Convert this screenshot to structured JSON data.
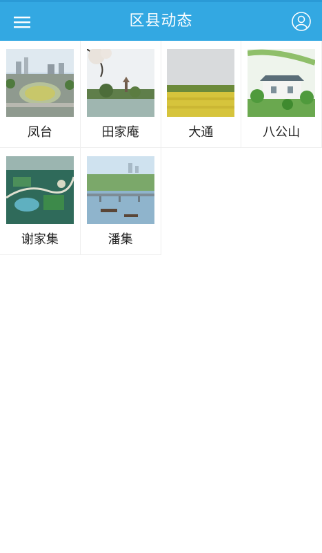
{
  "header": {
    "title": "区县动态",
    "menu_icon": "menu-icon",
    "user_icon": "user-icon"
  },
  "colors": {
    "header_bg": "#33a8e2",
    "header_text": "#ffffff"
  },
  "tiles": [
    {
      "label": "凤台",
      "image": "fengtai-roundabout-photo"
    },
    {
      "label": "田家庵",
      "image": "tianjiaan-lake-pagoda-photo"
    },
    {
      "label": "大通",
      "image": "datong-rapeseed-field-photo"
    },
    {
      "label": "八公山",
      "image": "bagongshan-building-photo"
    },
    {
      "label": "谢家集",
      "image": "xiejiaji-aerial-rendering-photo"
    },
    {
      "label": "潘集",
      "image": "panji-river-bridge-photo"
    }
  ]
}
